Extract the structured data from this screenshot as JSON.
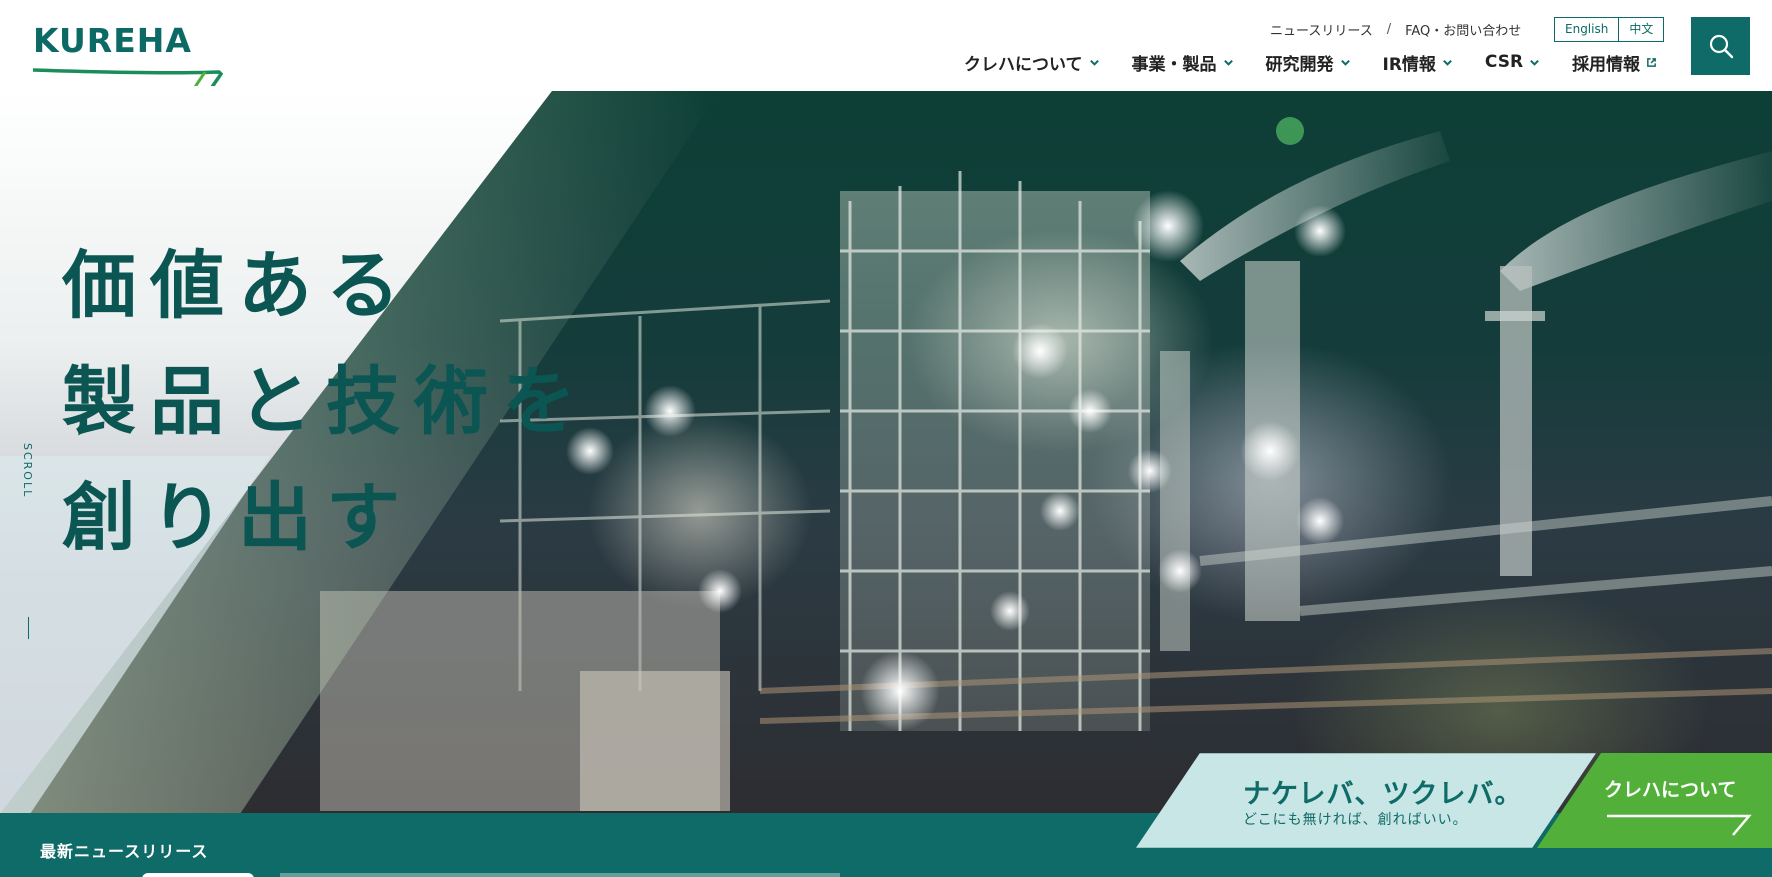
{
  "header": {
    "logo_text": "KUREHA",
    "util_links": [
      "ニュースリリース",
      "FAQ・お問い合わせ"
    ],
    "util_separator": "/",
    "languages": [
      "English",
      "中文"
    ],
    "search_icon": "search-icon",
    "nav": [
      {
        "label": "クレハについて",
        "icon": "chevron-down-icon"
      },
      {
        "label": "事業・製品",
        "icon": "chevron-down-icon"
      },
      {
        "label": "研究開発",
        "icon": "chevron-down-icon"
      },
      {
        "label": "IR情報",
        "icon": "chevron-down-icon"
      },
      {
        "label": "CSR",
        "icon": "chevron-down-icon"
      },
      {
        "label": "採用情報",
        "icon": "external-link-icon"
      }
    ]
  },
  "hero": {
    "catch_lines": [
      "価値ある",
      "製品と技術を",
      "創り出す"
    ],
    "scroll_label": "SCROLL",
    "banner_slogan": "ナケレバ、ツクレバ。",
    "banner_sub": "どこにも無ければ、創ればいい。",
    "banner_about": "クレハについて"
  },
  "news": {
    "title": "最新ニュースリリース"
  },
  "colors": {
    "brand": "#0e6b67",
    "brand_light": "#1a8d5a",
    "accent_green": "#52b03a",
    "banner_light": "#c9e6e6"
  }
}
